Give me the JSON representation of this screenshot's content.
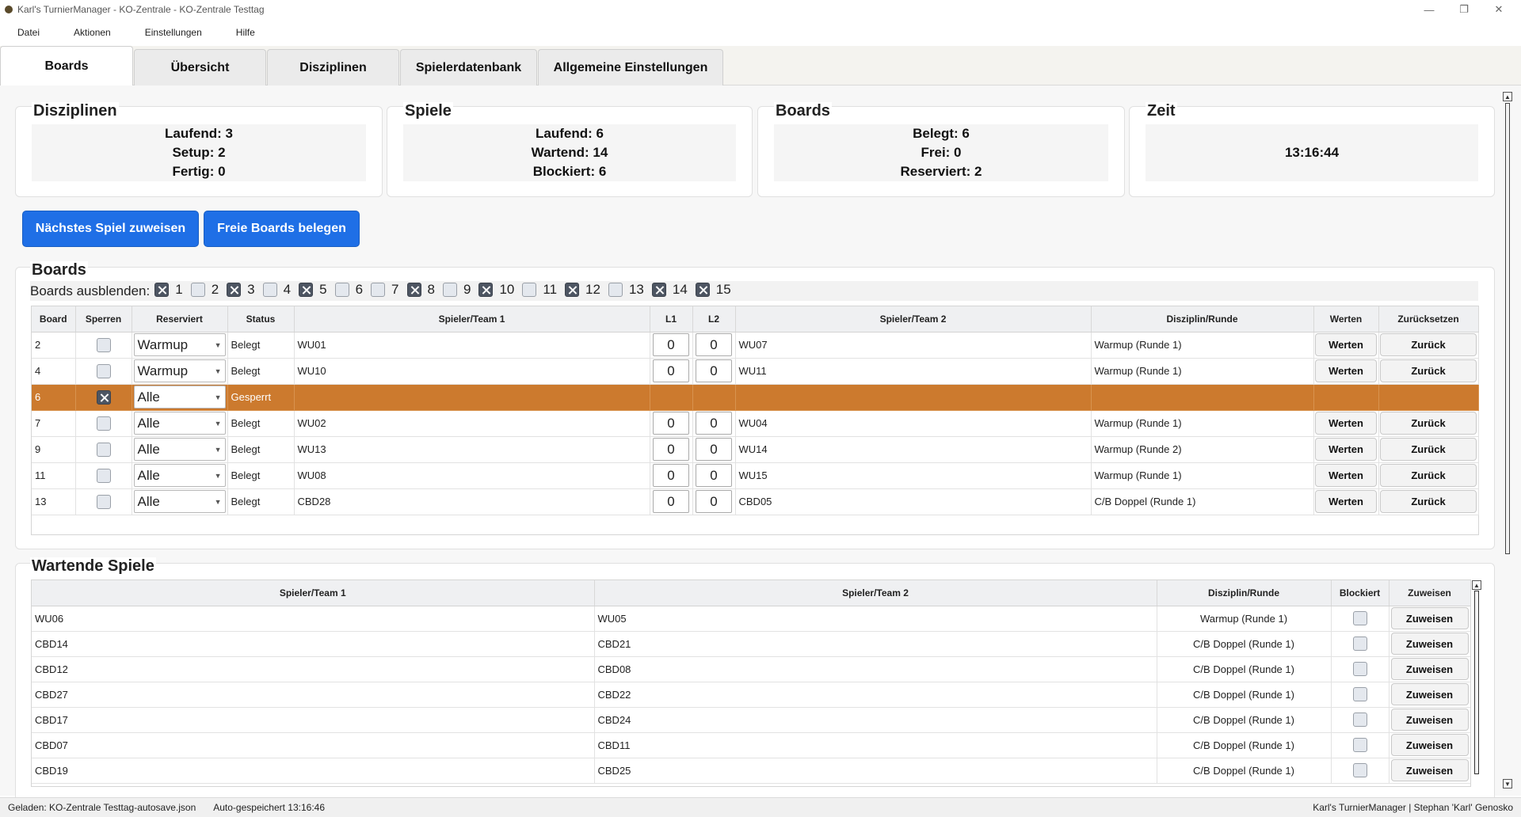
{
  "window": {
    "title": "Karl's TurnierManager - KO-Zentrale - KO-Zentrale Testtag",
    "minimize": "—",
    "restore": "❐",
    "close": "✕"
  },
  "menu": [
    "Datei",
    "Aktionen",
    "Einstellungen",
    "Hilfe"
  ],
  "tabs": [
    {
      "label": "Boards",
      "active": true
    },
    {
      "label": "Übersicht",
      "active": false
    },
    {
      "label": "Disziplinen",
      "active": false
    },
    {
      "label": "Spielerdatenbank",
      "active": false
    },
    {
      "label": "Allgemeine Einstellungen",
      "active": false
    }
  ],
  "summary": {
    "disziplinen": {
      "title": "Disziplinen",
      "lines": [
        "Laufend: 3",
        "Setup: 2",
        "Fertig: 0"
      ]
    },
    "spiele": {
      "title": "Spiele",
      "lines": [
        "Laufend: 6",
        "Wartend: 14",
        "Blockiert: 6"
      ]
    },
    "boards": {
      "title": "Boards",
      "lines": [
        "Belegt: 6",
        "Frei: 0",
        "Reserviert: 2"
      ]
    },
    "zeit": {
      "title": "Zeit",
      "lines": [
        "13:16:44"
      ]
    }
  },
  "actions": {
    "next_game": "Nächstes Spiel zuweisen",
    "fill_boards": "Freie Boards belegen"
  },
  "boards_section": {
    "title": "Boards",
    "hide_label": "Boards ausblenden:",
    "hide_items": [
      {
        "num": "1",
        "checked": true
      },
      {
        "num": "2",
        "checked": false
      },
      {
        "num": "3",
        "checked": true
      },
      {
        "num": "4",
        "checked": false
      },
      {
        "num": "5",
        "checked": true
      },
      {
        "num": "6",
        "checked": false
      },
      {
        "num": "7",
        "checked": false
      },
      {
        "num": "8",
        "checked": true
      },
      {
        "num": "9",
        "checked": false
      },
      {
        "num": "10",
        "checked": true
      },
      {
        "num": "11",
        "checked": false
      },
      {
        "num": "12",
        "checked": true
      },
      {
        "num": "13",
        "checked": false
      },
      {
        "num": "14",
        "checked": true
      },
      {
        "num": "15",
        "checked": true
      }
    ],
    "columns": [
      "Board",
      "Sperren",
      "Reserviert",
      "Status",
      "Spieler/Team 1",
      "L1",
      "L2",
      "Spieler/Team 2",
      "Disziplin/Runde",
      "Werten",
      "Zurücksetzen"
    ],
    "werten_label": "Werten",
    "zurueck_label": "Zurück",
    "rows": [
      {
        "board": "2",
        "locked": false,
        "reserved": "Warmup",
        "status": "Belegt",
        "team1": "WU01",
        "l1": "0",
        "l2": "0",
        "team2": "WU07",
        "disziplin": "Warmup (Runde 1)"
      },
      {
        "board": "4",
        "locked": false,
        "reserved": "Warmup",
        "status": "Belegt",
        "team1": "WU10",
        "l1": "0",
        "l2": "0",
        "team2": "WU11",
        "disziplin": "Warmup (Runde 1)"
      },
      {
        "board": "6",
        "locked": true,
        "reserved": "Alle",
        "status": "Gesperrt",
        "team1": "",
        "l1": "",
        "l2": "",
        "team2": "",
        "disziplin": ""
      },
      {
        "board": "7",
        "locked": false,
        "reserved": "Alle",
        "status": "Belegt",
        "team1": "WU02",
        "l1": "0",
        "l2": "0",
        "team2": "WU04",
        "disziplin": "Warmup (Runde 1)"
      },
      {
        "board": "9",
        "locked": false,
        "reserved": "Alle",
        "status": "Belegt",
        "team1": "WU13",
        "l1": "0",
        "l2": "0",
        "team2": "WU14",
        "disziplin": "Warmup (Runde 2)"
      },
      {
        "board": "11",
        "locked": false,
        "reserved": "Alle",
        "status": "Belegt",
        "team1": "WU08",
        "l1": "0",
        "l2": "0",
        "team2": "WU15",
        "disziplin": "Warmup (Runde 1)"
      },
      {
        "board": "13",
        "locked": false,
        "reserved": "Alle",
        "status": "Belegt",
        "team1": "CBD28",
        "l1": "0",
        "l2": "0",
        "team2": "CBD05",
        "disziplin": "C/B Doppel (Runde 1)"
      }
    ]
  },
  "waiting_section": {
    "title": "Wartende Spiele",
    "columns": [
      "Spieler/Team 1",
      "Spieler/Team 2",
      "Disziplin/Runde",
      "Blockiert",
      "Zuweisen"
    ],
    "assign_label": "Zuweisen",
    "rows": [
      {
        "team1": "WU06",
        "team2": "WU05",
        "disziplin": "Warmup (Runde 1)",
        "blocked": false
      },
      {
        "team1": "CBD14",
        "team2": "CBD21",
        "disziplin": "C/B Doppel (Runde 1)",
        "blocked": false
      },
      {
        "team1": "CBD12",
        "team2": "CBD08",
        "disziplin": "C/B Doppel (Runde 1)",
        "blocked": false
      },
      {
        "team1": "CBD27",
        "team2": "CBD22",
        "disziplin": "C/B Doppel (Runde 1)",
        "blocked": false
      },
      {
        "team1": "CBD17",
        "team2": "CBD24",
        "disziplin": "C/B Doppel (Runde 1)",
        "blocked": false
      },
      {
        "team1": "CBD07",
        "team2": "CBD11",
        "disziplin": "C/B Doppel (Runde 1)",
        "blocked": false
      },
      {
        "team1": "CBD19",
        "team2": "CBD25",
        "disziplin": "C/B Doppel (Runde 1)",
        "blocked": false
      }
    ]
  },
  "status": {
    "loaded": "Geladen: KO-Zentrale Testtag-autosave.json",
    "autosave": "Auto-gespeichert 13:16:46",
    "right": "Karl's TurnierManager | Stephan 'Karl' Genosko"
  },
  "colors": {
    "primary": "#1f6fe6",
    "locked_row": "#cc7a2e"
  }
}
